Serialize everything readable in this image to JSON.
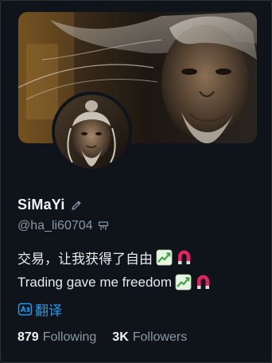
{
  "profile": {
    "display_name": "SiMaYi",
    "handle": "@ha_li60704",
    "bio_line_1": "交易，让我获得了自由",
    "bio_line_2": "Trading gave me freedom",
    "translate_label": "翻译",
    "following_count": "879",
    "following_label": "Following",
    "followers_count": "3K",
    "followers_label": "Followers"
  },
  "icons": {
    "edit": "pencil-icon",
    "handle_badge": "account-badge-icon",
    "chart_emoji": "chart-increasing-emoji",
    "magnet_emoji": "magnet-emoji",
    "translate": "translate-icon"
  },
  "colors": {
    "background": "#0f141a",
    "accent": "#1d9bf0",
    "muted_text": "#8b98a5",
    "primary_text": "#e7e9ea"
  }
}
